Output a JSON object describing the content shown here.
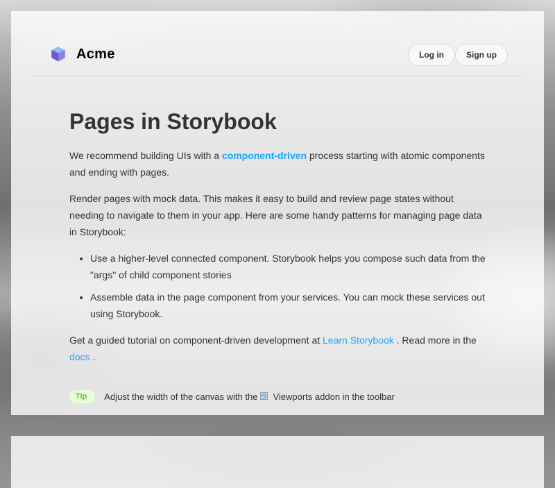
{
  "header": {
    "brand": "Acme",
    "login_label": "Log in",
    "signup_label": "Sign up"
  },
  "page": {
    "title": "Pages in Storybook",
    "intro_before": "We recommend building UIs with a",
    "intro_link": "component-driven",
    "intro_after": "process starting with atomic components and ending with pages.",
    "render_paragraph": "Render pages with mock data. This makes it easy to build and review page states without needing to navigate to them in your app. Here are some handy patterns for managing page data in Storybook:",
    "patterns": [
      "Use a higher-level connected component. Storybook helps you compose such data from the \"args\" of child component stories",
      "Assemble data in the page component from your services. You can mock these services out using Storybook."
    ],
    "tutorial_before": "Get a guided tutorial on component-driven development at",
    "tutorial_link": "Learn Storybook",
    "tutorial_middle": ". Read more in the",
    "docs_link": "docs",
    "tutorial_end": "."
  },
  "tip": {
    "badge": "Tip",
    "text_before": "Adjust the width of the canvas with the",
    "text_after": "Viewports addon in the toolbar"
  },
  "colors": {
    "link": "#1ea7fd",
    "tip_background": "#e7fdd8",
    "tip_text": "#66bf3c",
    "logo_light": "#91BAF8",
    "logo_dark": "#6A5ACD"
  },
  "icons": {
    "logo": "cube-logo-icon",
    "viewport": "viewport-icon"
  }
}
